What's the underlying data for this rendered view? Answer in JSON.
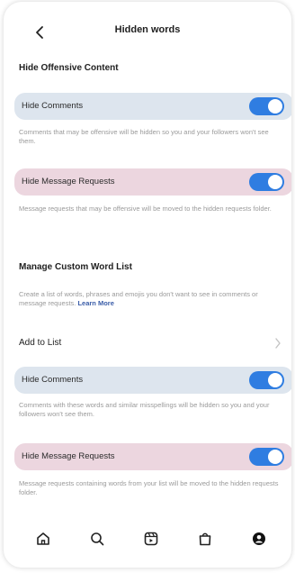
{
  "header": {
    "title": "Hidden words",
    "back_icon": "chevron-left-icon"
  },
  "offensive": {
    "section_title": "Hide Offensive Content",
    "hide_comments": {
      "label": "Hide Comments",
      "on": true,
      "description": "Comments that may be offensive will be hidden so you and your followers won't see them."
    },
    "hide_message_requests": {
      "label": "Hide Message Requests",
      "on": true,
      "description": "Message requests that may be offensive will be moved to the hidden requests folder."
    }
  },
  "custom": {
    "section_title": "Manage Custom Word List",
    "description": "Create a list of words, phrases and emojis you don't want to see in comments or message requests.",
    "learn_more": "Learn More",
    "add_to_list": "Add to List",
    "hide_comments": {
      "label": "Hide Comments",
      "on": true,
      "description": "Comments with these words and similar misspellings will be hidden so you and your followers won't see them."
    },
    "hide_message_requests": {
      "label": "Hide Message Requests",
      "on": true,
      "description": "Message requests containing words from your list will be moved to the hidden requests folder."
    }
  },
  "colors": {
    "toggle_on": "#2f7de1",
    "highlight_blue": "#dde5ee",
    "highlight_pink": "#ecd6df"
  },
  "bottom_nav": [
    {
      "icon": "home-icon"
    },
    {
      "icon": "search-icon"
    },
    {
      "icon": "reels-icon"
    },
    {
      "icon": "shop-icon"
    },
    {
      "icon": "profile-icon"
    }
  ]
}
